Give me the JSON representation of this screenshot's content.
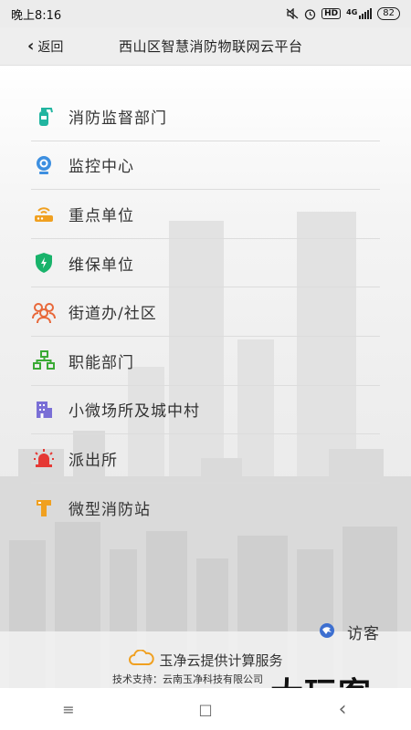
{
  "status_bar": {
    "time": "晚上8:16",
    "icons": [
      "mute-icon",
      "alarm-icon",
      "hd-icon",
      "signal-icon",
      "battery-icon"
    ],
    "hd_label": "HD",
    "network": "4G",
    "battery": "82"
  },
  "header": {
    "back_label": "返回",
    "title": "西山区智慧消防物联网云平台"
  },
  "menu": {
    "items": [
      {
        "label": "消防监督部门",
        "icon": "fire-extinguisher-icon",
        "color": "#21b5a0"
      },
      {
        "label": "监控中心",
        "icon": "webcam-icon",
        "color": "#3d8fe0"
      },
      {
        "label": "重点单位",
        "icon": "router-icon",
        "color": "#f0a020"
      },
      {
        "label": "维保单位",
        "icon": "shield-icon",
        "color": "#19b36b"
      },
      {
        "label": "街道办/社区",
        "icon": "people-group-icon",
        "color": "#e8683a"
      },
      {
        "label": "职能部门",
        "icon": "org-chart-icon",
        "color": "#3aaa35"
      },
      {
        "label": "小微场所及城中村",
        "icon": "building-icon",
        "color": "#7a6fd6"
      },
      {
        "label": "派出所",
        "icon": "police-light-icon",
        "color": "#e53935"
      },
      {
        "label": "微型消防站",
        "icon": "fire-station-icon",
        "color": "#f0a020"
      }
    ]
  },
  "visitor": {
    "label": "访客",
    "icon": "visitor-icon",
    "color": "#3d6fd0"
  },
  "footer": {
    "cloud_text": "玉净云提供计算服务",
    "cloud_color": "#f0a020",
    "support": "技术支持：云南玉净科技有限公司"
  },
  "watermark": "大玩客",
  "nav": {
    "menu_glyph": "≡",
    "home_glyph": "□",
    "back_glyph": "‹"
  }
}
